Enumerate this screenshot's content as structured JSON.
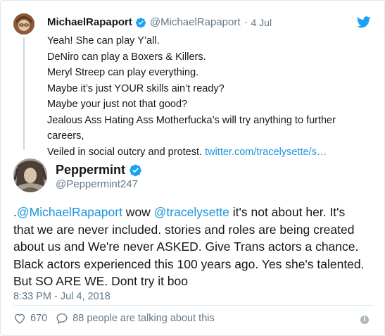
{
  "quoted_tweet": {
    "name": "MichaelRapaport",
    "handle": "@MichaelRapaport",
    "separator": "·",
    "date": "4 Jul",
    "lines": [
      "Yeah! She can play Y’all.",
      "DeNiro can play a Boxers & Killers.",
      "Meryl Streep can play everything.",
      "Maybe it’s just YOUR skills ain’t ready?",
      "Maybe your just not that good?",
      "Jealous Ass Hating Ass Motherfucka’s will try anything to further careers,",
      "Veiled in social outcry and protest. "
    ],
    "link": "twitter.com/tracelysette/s…"
  },
  "tweet": {
    "name": "Peppermint",
    "handle": "@Peppermint247",
    "body_prefix": ".",
    "mention_1": "@MichaelRapaport",
    "body_mid": " wow ",
    "mention_2": "@tracelysette",
    "body_line1_rest": " it's not about her. It's",
    "body_lines": [
      "that we are never included. stories and roles are being created",
      "about us and We're never ASKED. Give Trans actors a chance.",
      "Black actors experienced this 100 years ago. Yes she's talented.",
      "But SO ARE WE. Dont try it boo"
    ],
    "timestamp": "8:33 PM - Jul 4, 2018",
    "like_count": "670",
    "talking_text": "88 people are talking about this",
    "info_glyph": "i"
  },
  "colors": {
    "link": "#1b95e0",
    "muted": "#657786",
    "verified": "#1da1f2",
    "divider": "#e1e8ed"
  },
  "icons": {
    "brand": "twitter-bird-icon",
    "verified": "verified-badge-icon",
    "like": "heart-icon",
    "reply": "speech-bubble-icon",
    "info": "info-icon"
  }
}
